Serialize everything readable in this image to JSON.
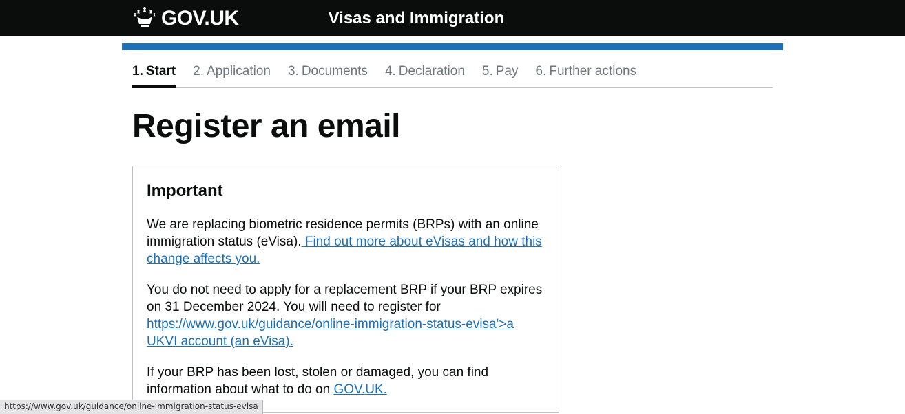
{
  "header": {
    "logotype": "GOV.UK",
    "service_name": "Visas and Immigration"
  },
  "nav": {
    "items": [
      {
        "num": "1.",
        "label": "Start",
        "active": true
      },
      {
        "num": "2.",
        "label": "Application",
        "active": false
      },
      {
        "num": "3.",
        "label": "Documents",
        "active": false
      },
      {
        "num": "4.",
        "label": "Declaration",
        "active": false
      },
      {
        "num": "5.",
        "label": "Pay",
        "active": false
      },
      {
        "num": "6.",
        "label": "Further actions",
        "active": false
      }
    ]
  },
  "page": {
    "heading": "Register an email"
  },
  "important": {
    "heading": "Important",
    "p1_text": "We are replacing biometric residence permits (BRPs) with an online immigration status (eVisa).",
    "p1_link": " Find out more about eVisas and how this change affects you.",
    "p2_text": "You do not need to apply for a replacement BRP if your BRP expires on 31 December 2024. You will need to register for ",
    "p2_link": "https://www.gov.uk/guidance/online-immigration-status-evisa'>a UKVI account (an eVisa).",
    "p3_text": "If your BRP has been lost, stolen or damaged, you can find information about what to do on ",
    "p3_link": "GOV.UK."
  },
  "status_bar": "https://www.gov.uk/guidance/online-immigration-status-evisa"
}
